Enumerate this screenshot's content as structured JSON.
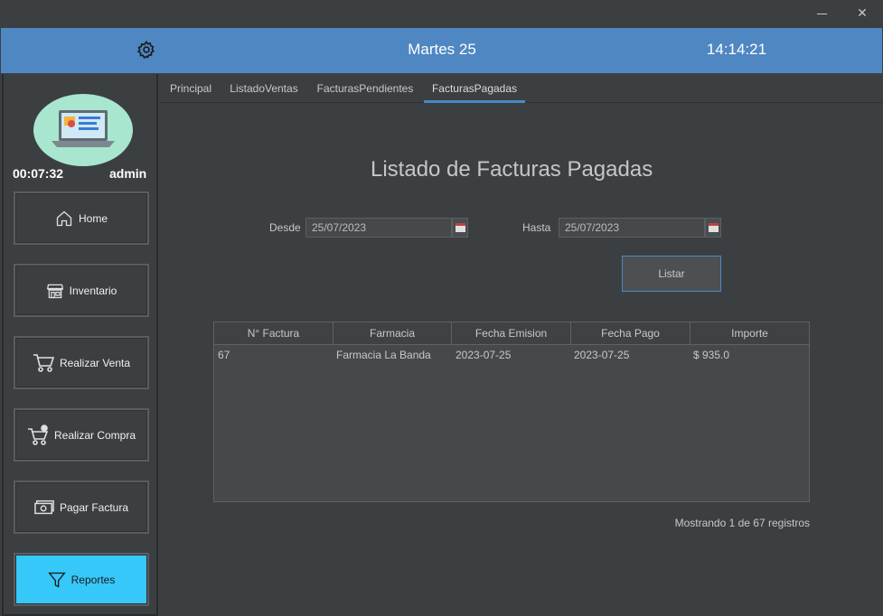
{
  "header": {
    "date": "Martes 25",
    "clock": "14:14:21"
  },
  "session": {
    "timer": "00:07:32",
    "user": "admin"
  },
  "sidebar": {
    "items": [
      {
        "label": "Home",
        "icon": "home-icon"
      },
      {
        "label": "Inventario",
        "icon": "store-icon"
      },
      {
        "label": "Realizar Venta",
        "icon": "cart-icon"
      },
      {
        "label": "Realizar Compra",
        "icon": "cart-plus-icon"
      },
      {
        "label": "Pagar Factura",
        "icon": "money-icon"
      },
      {
        "label": "Reportes",
        "icon": "filter-icon"
      }
    ],
    "active_index": 5
  },
  "tabs": [
    "Principal",
    "ListadoVentas",
    "FacturasPendientes",
    "FacturasPagadas"
  ],
  "active_tab": 3,
  "main": {
    "title": "Listado de Facturas Pagadas",
    "desde_label": "Desde",
    "desde_value": "25/07/2023",
    "hasta_label": "Hasta",
    "hasta_value": "25/07/2023",
    "listar_label": "Listar"
  },
  "table": {
    "columns": [
      "N° Factura",
      "Farmacia",
      "Fecha Emision",
      "Fecha Pago",
      "Importe"
    ],
    "rows": [
      [
        "67",
        "Farmacia La Banda",
        "2023-07-25",
        "2023-07-25",
        "$ 935.0"
      ]
    ]
  },
  "footer": {
    "status": "Mostrando 1 de 67 registros"
  },
  "colors": {
    "header": "#4f87c3",
    "active_nav": "#36c8f8",
    "background": "#3c3f41",
    "tab_indicator": "#4a88c7"
  }
}
